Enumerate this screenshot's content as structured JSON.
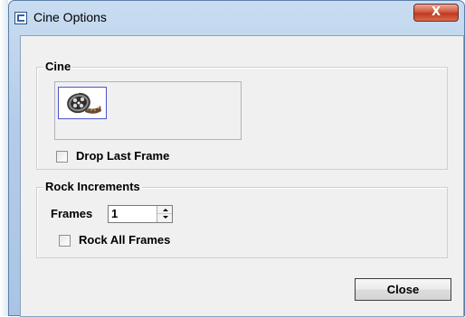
{
  "window": {
    "title": "Cine Options",
    "close_glyph": "X"
  },
  "cine_group": {
    "legend": "Cine",
    "reel_icon": "film-reel-icon",
    "drop_last_frame": {
      "label": "Drop Last Frame",
      "checked": false
    }
  },
  "rock_group": {
    "legend": "Rock Increments",
    "frames": {
      "label": "Frames",
      "value": "1"
    },
    "rock_all_frames": {
      "label": "Rock All Frames",
      "checked": false
    }
  },
  "footer": {
    "close_label": "Close"
  },
  "colors": {
    "title_close_button": "#c0391f",
    "reel_button_border": "#4e54c8",
    "client_background": "#f0f0f0"
  }
}
